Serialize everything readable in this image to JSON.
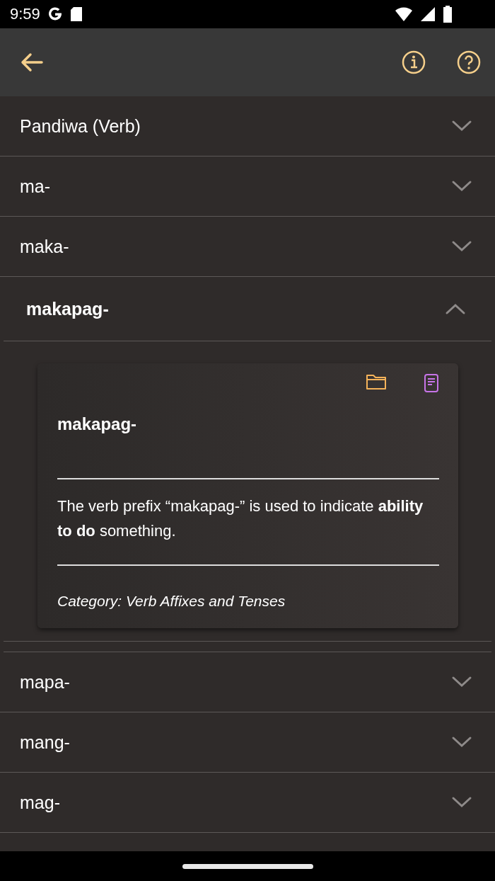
{
  "status_bar": {
    "time": "9:59"
  },
  "sections": [
    {
      "title": "Pandiwa (Verb)",
      "expanded": false
    },
    {
      "title": "ma-",
      "expanded": false
    },
    {
      "title": "maka-",
      "expanded": false
    },
    {
      "title": "makapag-",
      "expanded": true,
      "card": {
        "title": "makapag-",
        "description": "The verb prefix “makapag-” is used to indicate **ability to do** something.",
        "category": "Category: Verb Affixes and Tenses"
      }
    },
    {
      "title": "mapa-",
      "expanded": false
    },
    {
      "title": "mang-",
      "expanded": false
    },
    {
      "title": "mag-",
      "expanded": false
    }
  ]
}
